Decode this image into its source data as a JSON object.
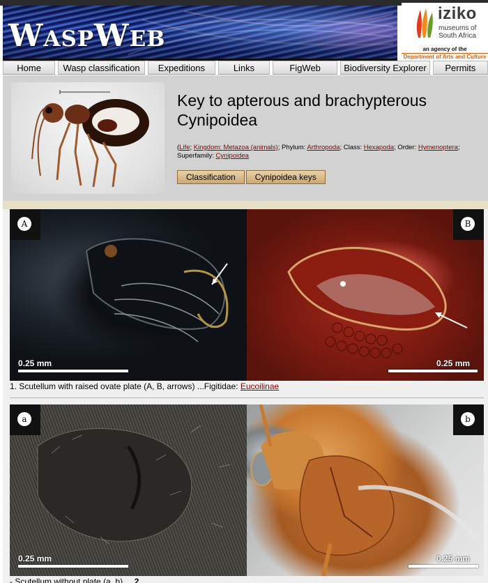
{
  "site": {
    "title": "WaspWeb",
    "logo": {
      "name": "iziko",
      "line1": "museums of",
      "line2": "South Africa",
      "agency": "an agency of the",
      "department": "Department of Arts and Culture"
    }
  },
  "nav": {
    "items": [
      {
        "label": "Home"
      },
      {
        "label": "Wasp classification"
      },
      {
        "label": "Expeditions"
      },
      {
        "label": "Links"
      },
      {
        "label": "FigWeb"
      },
      {
        "label": "Biodiversity Explorer"
      },
      {
        "label": "Permits"
      }
    ]
  },
  "header": {
    "title": "Key to apterous and brachypterous Cynipoidea",
    "taxonomy": {
      "open_paren": "(",
      "life": "Life",
      "kingdom": "Kingdom: Metazoa (animals)",
      "phylum_label": "; Phylum: ",
      "phylum": "Arthropoda",
      "class_label": "; Class: ",
      "class": "Hexapoda",
      "order_label": "; Order: ",
      "order": "Hymenoptera",
      "superfamily_label": "; Superfamily: ",
      "superfamily": "Cynipoidea"
    },
    "buttons": {
      "classification": "Classification",
      "keys": "Cynipoidea keys"
    }
  },
  "couplets": [
    {
      "photos": [
        {
          "badge": "A",
          "scale": "0.25 mm"
        },
        {
          "badge": "B",
          "scale": "0.25 mm"
        }
      ],
      "text": "1. Scutellum with raised ovate plate (A, B, arrows) ...Figitidae: ",
      "link": "Eucoilinae"
    },
    {
      "photos": [
        {
          "badge": "a",
          "scale": "0.25 mm"
        },
        {
          "badge": "b",
          "scale": "0.25 mm"
        }
      ],
      "text": "- Scutellum without plate (a, b) ....",
      "link": "2"
    }
  ]
}
